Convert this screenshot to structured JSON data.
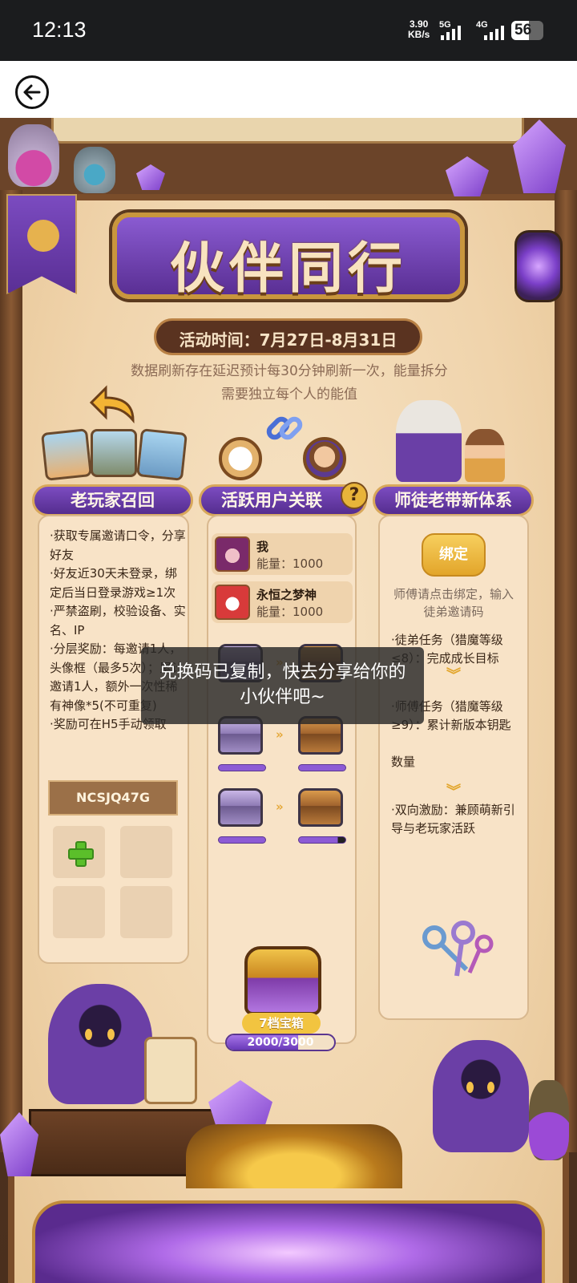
{
  "status_bar": {
    "time": "12:13",
    "speed_value": "3.90",
    "speed_unit": "KB/s",
    "net1": "5G",
    "net2": "4G",
    "battery": "56"
  },
  "nav": {
    "back_icon": "back-arrow-icon"
  },
  "event": {
    "title": "伙伴同行",
    "date": "活动时间：7月27日-8月31日",
    "notice": "数据刷新存在延迟预计每30分钟刷新一次，能量拆分需要独立每个人的能值"
  },
  "columns": {
    "recall": {
      "header": "老玩家召回",
      "rules": [
        "·获取专属邀请口令，分享好友",
        "·好友近30天未登录，绑定后当日登录游戏≥1次",
        "·严禁盗刷，校验设备、实名、IP",
        "·分层奖励：每邀请1人，头像框（最多5次）；累计邀请1人，额外一次性稀有神像*5(不可重复)",
        "·奖励可在H5手动领取"
      ],
      "code": "NCSJQ47G"
    },
    "active": {
      "header": "活跃用户关联",
      "help": "?",
      "users": [
        {
          "name": "我",
          "energy": "能量：1000"
        },
        {
          "name": "永恒之梦神",
          "energy": "能量：1000"
        }
      ],
      "big_chest_label": "7档宝箱",
      "progress_text": "2000/3000",
      "progress_fraction": 0.667
    },
    "mentor": {
      "header": "师徒老带新体系",
      "bind_button": "绑定",
      "bind_hint": "师傅请点击绑定，输入徒弟邀请码",
      "task_apprentice": "·徒弟任务（猎魔等级≤8）：完成成长目标",
      "task_master": "·师傅任务（猎魔等级≥9）：累计新版本钥匙",
      "task_master_tail": "数量",
      "incentive": "·双向激励：兼顾萌新引导与老玩家活跃"
    }
  },
  "toast": "兑换码已复制，快去分享给你的小伙伴吧~",
  "colors": {
    "purple": "#6a3ab8",
    "gold": "#e2a52a",
    "parchment": "#f8e3c7"
  }
}
